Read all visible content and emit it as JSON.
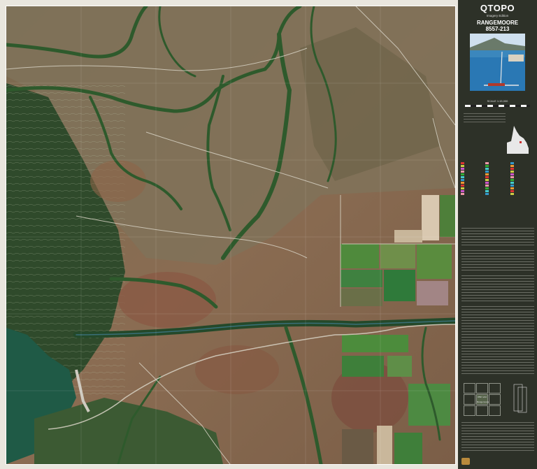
{
  "header": {
    "brand": "QTOPO",
    "edition": "Imagery Edition",
    "map_name": "RANGEMOORE",
    "map_number": "8557-213"
  },
  "scale": {
    "label": "SCALE 1:15,000"
  },
  "index_sheets": [
    {
      "name": "",
      "center": false
    },
    {
      "name": "",
      "center": false
    },
    {
      "name": "",
      "center": false
    },
    {
      "name": "",
      "center": false
    },
    {
      "name": "8557-213 Rangemoore",
      "center": true
    },
    {
      "name": "",
      "center": false
    },
    {
      "name": "",
      "center": false
    },
    {
      "name": "",
      "center": false
    },
    {
      "name": "",
      "center": false
    }
  ],
  "colors": {
    "panel_bg": "#2d3128",
    "frame": "#e9e6de",
    "water": "#1f5a46",
    "vegetation": "#2e5a2c",
    "crop_green": "#4f8a3c",
    "bare_red": "#8a5a45",
    "grass_tan": "#8c7d58"
  },
  "icons": [
    "queensland-locator-icon",
    "cover-photo-jetty",
    "scale-bar-icon"
  ]
}
